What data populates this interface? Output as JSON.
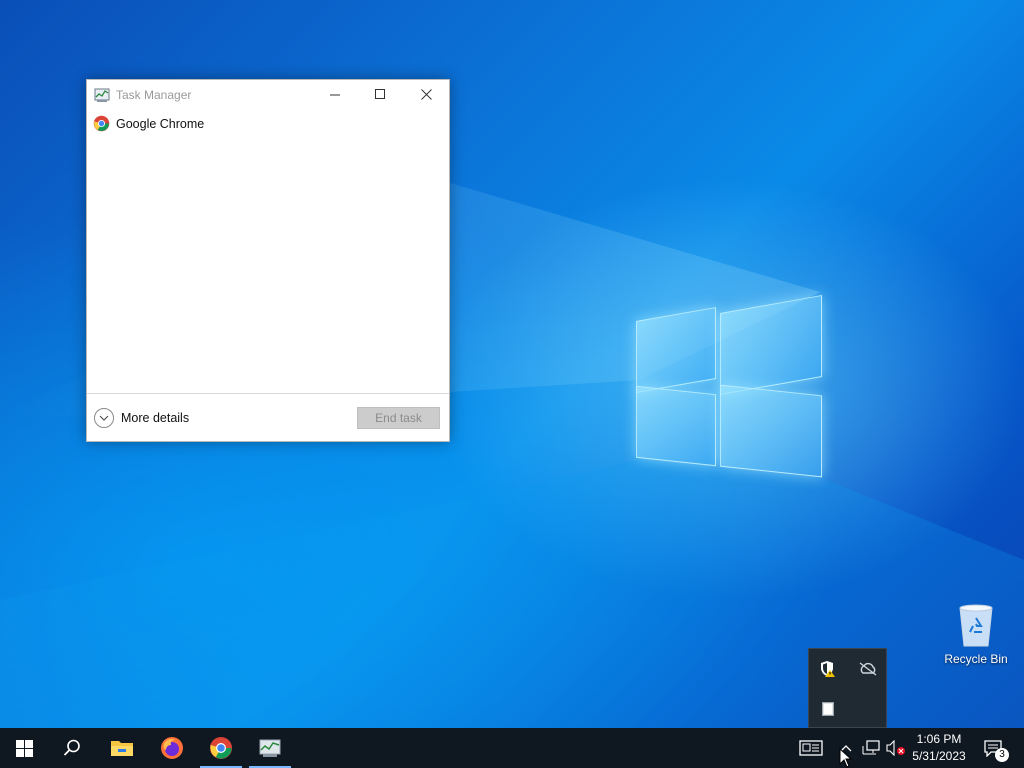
{
  "task_manager": {
    "title": "Task Manager",
    "controls": {
      "minimize": "minimize-icon",
      "maximize": "maximize-icon",
      "close": "close-icon"
    },
    "apps": [
      {
        "name": "Google Chrome",
        "icon": "chrome-icon"
      }
    ],
    "more_details_label": "More details",
    "end_task_label": "End task"
  },
  "desktop": {
    "icons": [
      {
        "label": "Recycle Bin",
        "icon": "recycle-bin-icon"
      }
    ]
  },
  "tray_flyout": {
    "icons": [
      "security-warning-icon",
      "onedrive-offline-icon",
      "app-tray-icon"
    ]
  },
  "taskbar": {
    "pinned": [
      {
        "icon": "windows-start-icon",
        "active": false
      },
      {
        "icon": "search-icon",
        "active": false
      },
      {
        "icon": "file-explorer-icon",
        "active": false
      },
      {
        "icon": "firefox-icon",
        "active": false
      },
      {
        "icon": "chrome-icon",
        "active": true
      },
      {
        "icon": "task-manager-icon",
        "active": true
      }
    ],
    "tray": {
      "icons": [
        "news-icon",
        "show-hidden-chevron-icon",
        "network-icon",
        "volume-muted-icon"
      ],
      "time": "1:06 PM",
      "date": "5/31/2023",
      "notification_count": "3"
    }
  },
  "colors": {
    "taskbar_bg": "#0f1720",
    "accent": "#7ab8ff",
    "wallpaper_blue": "#0b74d8"
  }
}
